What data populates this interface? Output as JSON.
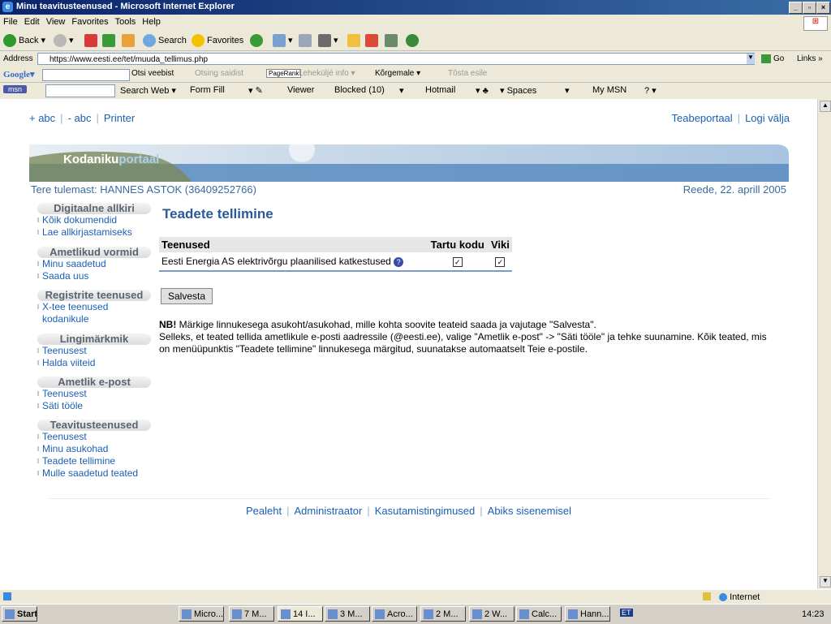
{
  "window": {
    "title": "Minu teavitusteenused - Microsoft Internet Explorer"
  },
  "menu": [
    "File",
    "Edit",
    "View",
    "Favorites",
    "Tools",
    "Help"
  ],
  "toolbar": {
    "back": "Back",
    "search": "Search",
    "favorites": "Favorites"
  },
  "address": {
    "label": "Address",
    "url": "https://www.eesti.ee/tet/muuda_tellimus.php",
    "go": "Go",
    "links": "Links"
  },
  "googlebar": {
    "logo": "Google",
    "otsi": "Otsi veebist",
    "otsing": "Otsing saidist",
    "pagerank": "PageRank",
    "lehe": "Leheküljé info",
    "korg": "Kõrgemale",
    "tosta": "Tõsta esile"
  },
  "msnbar": {
    "logo": "msn",
    "search_web": "Search Web",
    "form_fill": "Form Fill",
    "viewer": "Viewer",
    "blocked": "Blocked (10)",
    "hotmail": "Hotmail",
    "spaces": "Spaces",
    "mymsn": "My MSN"
  },
  "page": {
    "top_links": [
      "+ abc",
      "- abc",
      "Printer"
    ],
    "right_links": [
      "Teabeportaal",
      "Logi välja"
    ],
    "banner": {
      "logo_a": "Kodaniku",
      "logo_b": "portaal"
    },
    "greeting": "Tere tulemast: HANNES ASTOK (36409252766)",
    "date": "Reede, 22. aprill 2005",
    "sidebar": [
      {
        "title": "Digitaalne allkiri",
        "items": [
          "Kõik dokumendid",
          "Lae allkirjastamiseks"
        ]
      },
      {
        "title": "Ametlikud vormid",
        "items": [
          "Minu saadetud",
          "Saada uus"
        ]
      },
      {
        "title": "Registrite teenused",
        "items": [
          "X-tee teenused kodanikule"
        ]
      },
      {
        "title": "Lingimärkmik",
        "items": [
          "Teenusest",
          "Halda viiteid"
        ]
      },
      {
        "title": "Ametlik e-post",
        "items": [
          "Teenusest",
          "Säti tööle"
        ]
      },
      {
        "title": "Teavitusteenused",
        "items": [
          "Teenusest",
          "Minu asukohad",
          "Teadete tellimine",
          "Mulle saadetud teated"
        ]
      }
    ],
    "heading": "Teadete tellimine",
    "table": {
      "headers": [
        "Teenused",
        "Tartu kodu",
        "Viki"
      ],
      "row": {
        "label": "Eesti Energia AS elektrivõrgu plaanilised katkestused",
        "tartu": true,
        "viki": true
      }
    },
    "save_button": "Salvesta",
    "note_bold": "NB!",
    "note_1": " Märkige linnukesega asukoht/asukohad, mille kohta soovite teateid saada ja vajutage \"Salvesta\".",
    "note_2": "Selleks, et teated tellida ametlikule e-posti aadressile (@eesti.ee), valige \"Ametlik e-post\" -> \"Säti tööle\" ja tehke suunamine. Kõik teated, mis on menüüpunktis \"Teadete tellimine\" linnukesega märgitud, suunatakse automaatselt Teie e-postile.",
    "footer": [
      "Pealeht",
      "Administraator",
      "Kasutamistingimused",
      "Abiks sisenemisel"
    ]
  },
  "status": {
    "zone": "Internet"
  },
  "taskbar": {
    "start": "Start",
    "tasks": [
      "Micro...",
      "7 M...",
      "14 I...",
      "3 M...",
      "Acro...",
      "2 M...",
      "2 W...",
      "Calc...",
      "Hann..."
    ],
    "tray": [
      "ET"
    ],
    "clock": "14:23"
  }
}
